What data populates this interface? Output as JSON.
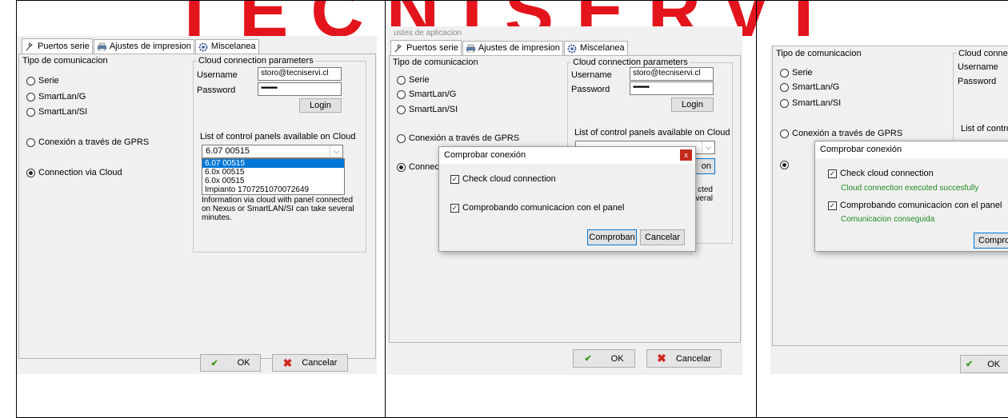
{
  "watermark": {
    "text": "TECNISERVI",
    "color": "#e3141c"
  },
  "tabs": {
    "serial": "Puertos serie",
    "print": "Ajustes de impresion",
    "misc": "Miscelanea"
  },
  "window_title_partial": "ustes de aplicacion",
  "comm_type": {
    "title": "Tipo de comunicacion",
    "options": [
      "Serie",
      "SmartLan/G",
      "SmartLan/SI",
      "Conexión a través de GPRS",
      "Connection via Cloud"
    ],
    "selected": "Connection via Cloud",
    "option_short_cloud": "Connectio"
  },
  "cloud": {
    "title": "Cloud connection parameters",
    "title_partial": "Cloud connectio",
    "username_label": "Username",
    "username_value": "storo@tecniservi.cl",
    "password_label": "Password",
    "password_value": "••••••••",
    "login_button": "Login",
    "login_partial": "on",
    "panels_label": "List of control panels available on Cloud",
    "panels_label_partial": "List of control p",
    "selected_panel": "6.07 00515",
    "panel_options": [
      "6.07 00515",
      "6.0x 00515",
      "6.0x 00515",
      "Impianto 1707251070072649"
    ],
    "note_lines": [
      "Information via cloud with panel connected",
      "on Nexus or SmartLAN/SI can take several",
      "minutes."
    ],
    "note_partial": [
      "cted",
      "veral"
    ]
  },
  "footer": {
    "ok": "OK",
    "cancel": "Cancelar",
    "ok_partial": "OK"
  },
  "dialog": {
    "title": "Comprobar conexión",
    "close": "x",
    "check1": "Check cloud connection",
    "check2": "Comprobando comunicacion con el panel",
    "check1_status": "Cloud connection executed succesfully",
    "check2_status": "Comunicacion conseguida",
    "primary_button": "Comproban",
    "primary_button_partial": "Comprob",
    "cancel_button": "Cancelar"
  },
  "colors": {
    "success_text": "#1f8a1f",
    "accent": "#0078d7",
    "close_button": "#c42b1c"
  }
}
